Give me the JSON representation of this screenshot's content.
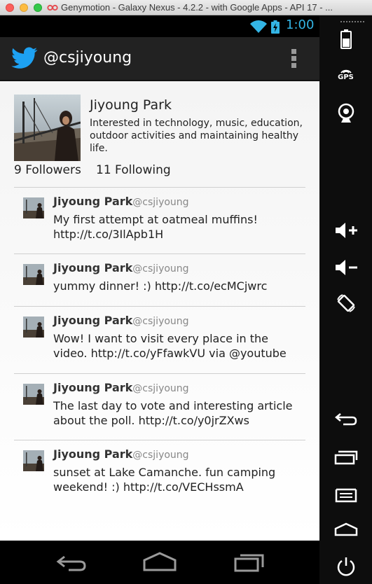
{
  "window": {
    "title": "Genymotion - Galaxy Nexus - 4.2.2 - with Google Apps - API 17 - ..."
  },
  "statusbar": {
    "time": "1:00"
  },
  "actionbar": {
    "title": "@csjiyoung"
  },
  "profile": {
    "name": "Jiyoung Park",
    "bio": "Interested in technology, music, education, outdoor activities and maintaining healthy life.",
    "followers": "9 Followers",
    "following": "11 Following"
  },
  "tweets": [
    {
      "name": "Jiyoung Park",
      "handle": "@csjiyoung",
      "text": "My first attempt at oatmeal muffins! http://t.co/3IlApb1H"
    },
    {
      "name": "Jiyoung Park",
      "handle": "@csjiyoung",
      "text": "yummy dinner! :) http://t.co/ecMCjwrc"
    },
    {
      "name": "Jiyoung Park",
      "handle": "@csjiyoung",
      "text": "Wow! I want to visit every place in the video. http://t.co/yFfawkVU via @youtube"
    },
    {
      "name": "Jiyoung Park",
      "handle": "@csjiyoung",
      "text": "The last day to vote and interesting article about the poll. http://t.co/y0jrZXws"
    },
    {
      "name": "Jiyoung Park",
      "handle": "@csjiyoung",
      "text": "sunset at Lake Camanche. fun camping weekend! :) http://t.co/VECHssmA"
    }
  ],
  "sidepanel": {
    "gps_label": "GPS"
  },
  "colors": {
    "twitter_blue": "#1da1f2",
    "status_accent": "#33b5e5",
    "actionbar_bg": "#222222"
  }
}
